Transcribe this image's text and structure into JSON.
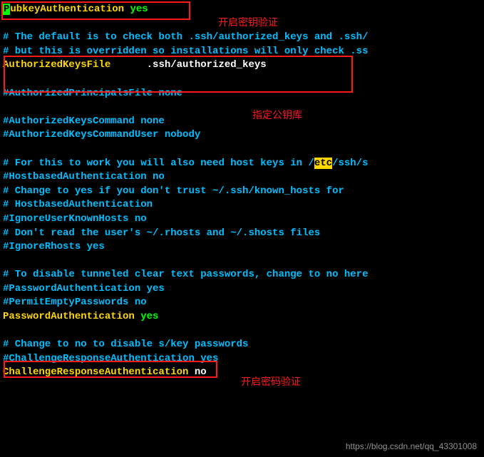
{
  "notes": {
    "pubkey": "开启密钥验证",
    "authkeys": "指定公钥库",
    "password": "开启密码验证"
  },
  "watermark": "https://blog.csdn.net/qq_43301008",
  "lines": [
    {
      "parts": [
        {
          "t": "P",
          "cls": "cursor"
        },
        {
          "t": "ubkeyAuthentication ",
          "cls": "yellow"
        },
        {
          "t": "yes",
          "cls": "green"
        }
      ]
    },
    {
      "parts": []
    },
    {
      "parts": [
        {
          "t": "# The default is to check both .ssh/authorized_keys and .ssh/",
          "cls": "cyan"
        }
      ]
    },
    {
      "parts": [
        {
          "t": "# but this is overridden so installations will only check .ss",
          "cls": "cyan"
        }
      ]
    },
    {
      "parts": [
        {
          "t": "AuthorizedKeysFile      ",
          "cls": "yellow"
        },
        {
          "t": ".ssh/authorized_keys",
          "cls": "white"
        }
      ]
    },
    {
      "parts": []
    },
    {
      "parts": [
        {
          "t": "#AuthorizedPrincipalsFile none",
          "cls": "cyan"
        }
      ]
    },
    {
      "parts": []
    },
    {
      "parts": [
        {
          "t": "#AuthorizedKeysCommand none",
          "cls": "cyan"
        }
      ]
    },
    {
      "parts": [
        {
          "t": "#AuthorizedKeysCommandUser nobody",
          "cls": "cyan"
        }
      ]
    },
    {
      "parts": []
    },
    {
      "parts": [
        {
          "t": "# For this to work you will also need host keys in /",
          "cls": "cyan"
        },
        {
          "t": "etc",
          "cls": "highlight-yellow"
        },
        {
          "t": "/ssh/s",
          "cls": "cyan"
        }
      ]
    },
    {
      "parts": [
        {
          "t": "#HostbasedAuthentication no",
          "cls": "cyan"
        }
      ]
    },
    {
      "parts": [
        {
          "t": "# Change to yes if you don't trust ~/.ssh/known_hosts for",
          "cls": "cyan"
        }
      ]
    },
    {
      "parts": [
        {
          "t": "# HostbasedAuthentication",
          "cls": "cyan"
        }
      ]
    },
    {
      "parts": [
        {
          "t": "#IgnoreUserKnownHosts no",
          "cls": "cyan"
        }
      ]
    },
    {
      "parts": [
        {
          "t": "# Don't read the user's ~/.rhosts and ~/.shosts files",
          "cls": "cyan"
        }
      ]
    },
    {
      "parts": [
        {
          "t": "#IgnoreRhosts yes",
          "cls": "cyan"
        }
      ]
    },
    {
      "parts": []
    },
    {
      "parts": [
        {
          "t": "# To disable tunneled clear text passwords, change to no here",
          "cls": "cyan"
        }
      ]
    },
    {
      "parts": [
        {
          "t": "#PasswordAuthentication yes",
          "cls": "cyan"
        }
      ]
    },
    {
      "parts": [
        {
          "t": "#PermitEmptyPasswords no",
          "cls": "cyan"
        }
      ]
    },
    {
      "parts": [
        {
          "t": "PasswordAuthentication ",
          "cls": "yellow"
        },
        {
          "t": "yes",
          "cls": "green"
        }
      ]
    },
    {
      "parts": []
    },
    {
      "parts": [
        {
          "t": "# Change to no to disable s/key passwords",
          "cls": "cyan"
        }
      ]
    },
    {
      "parts": [
        {
          "t": "#ChallengeResponseAuthentication yes",
          "cls": "cyan"
        }
      ]
    },
    {
      "parts": [
        {
          "t": "ChallengeResponseAuthentication ",
          "cls": "yellow"
        },
        {
          "t": "no",
          "cls": "white"
        }
      ]
    }
  ]
}
